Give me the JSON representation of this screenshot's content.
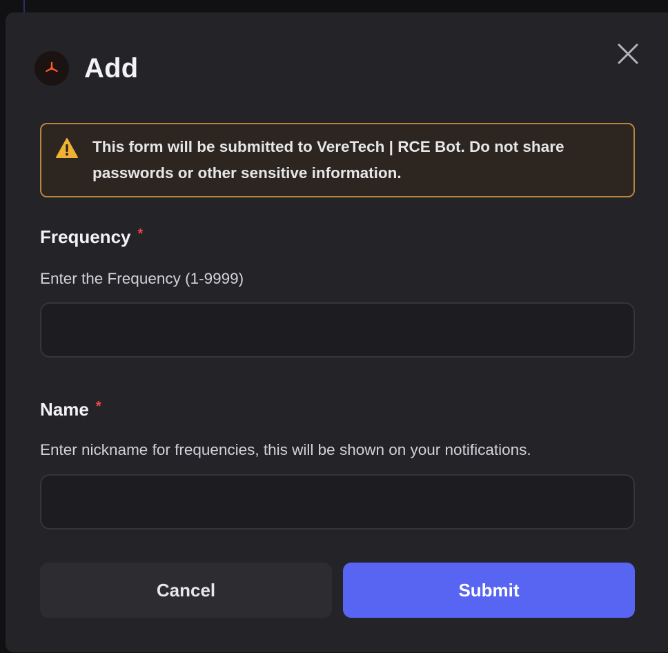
{
  "dialog": {
    "title": "Add",
    "app_icon": "app-logo-icon",
    "close_icon": "close-icon"
  },
  "warning": {
    "icon": "warning-icon",
    "text_line1": "This form will be submitted to VereTech | RCE Bot. Do not share",
    "text_line2": "passwords or other sensitive information.",
    "border_color": "#b9853c"
  },
  "fields": [
    {
      "label": "Frequency",
      "required_mark": "*",
      "description": "Enter the Frequency (1-9999)",
      "value": ""
    },
    {
      "label": "Name",
      "required_mark": "*",
      "description": "Enter nickname for frequencies, this will be shown on your notifications.",
      "value": ""
    }
  ],
  "buttons": {
    "cancel_label": "Cancel",
    "submit_label": "Submit",
    "submit_color": "#5865f2"
  }
}
